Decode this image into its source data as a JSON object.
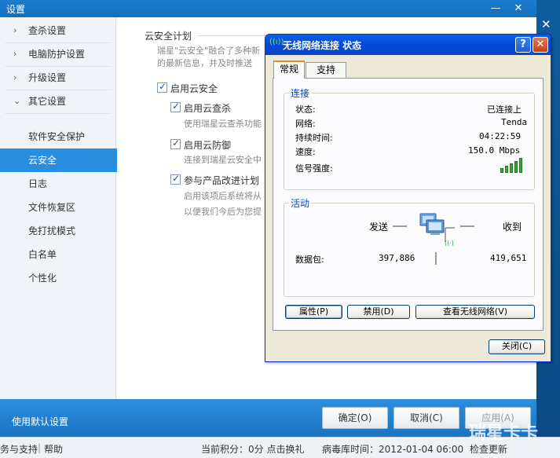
{
  "main_window": {
    "title": "设置",
    "min_glyph": "—",
    "close_glyph": "✕"
  },
  "sidebar": {
    "groups": [
      {
        "label": "查杀设置",
        "arrow": "›"
      },
      {
        "label": "电脑防护设置",
        "arrow": "›"
      },
      {
        "label": "升级设置",
        "arrow": "›"
      },
      {
        "label": "其它设置",
        "arrow": "⌄"
      }
    ],
    "sub_items": [
      "软件安全保护",
      "云安全",
      "日志",
      "文件恢复区",
      "免打扰模式",
      "白名单",
      "个性化"
    ],
    "active_index": 1
  },
  "content": {
    "section_title": "云安全计划",
    "desc_line1": "瑞星\"云安全\"融合了多种新",
    "desc_line2": "的最新信息，并及时推送",
    "enable_cloud": {
      "label": "启用云安全",
      "checked": true
    },
    "cloud_scan": {
      "label": "启用云查杀",
      "desc": "使用瑞星云查杀功能",
      "checked": true
    },
    "cloud_defense": {
      "label": "启用云防御",
      "desc": "连接到瑞星云安全中",
      "checked": true
    },
    "improve_plan": {
      "label": "参与产品改进计划",
      "desc1": "启用该项后系统将从",
      "desc2": "以便我们今后为您提",
      "checked": true
    }
  },
  "bottom": {
    "default_settings": "使用默认设置",
    "ok": "确定(O)",
    "cancel": "取消(C)",
    "apply": "应用(A)"
  },
  "status_bar": {
    "left": "务与支持",
    "help": "帮助",
    "points": "当前积分：0分 点击换礼",
    "virus_db": "病毒库时间：2012-01-04 06:00",
    "check_update": "检查更新"
  },
  "watermark": "瑞星卡卡",
  "right_close": "✕",
  "dialog": {
    "title": "无线网络连接 状态",
    "help_glyph": "?",
    "close_glyph": "✕",
    "tabs": [
      "常规",
      "支持"
    ],
    "connection": {
      "group_label": "连接",
      "status_label": "状态:",
      "status_value": "已连接上",
      "network_label": "网络:",
      "network_value": "Tenda",
      "duration_label": "持续时间:",
      "duration_value": "04:22:59",
      "speed_label": "速度:",
      "speed_value": "150.0 Mbps",
      "signal_label": "信号强度:",
      "signal_level": 5,
      "signal_max": 5
    },
    "activity": {
      "group_label": "活动",
      "sent_label": "发送",
      "received_label": "收到",
      "packets_label": "数据包:",
      "sent_value": "397,886",
      "received_value": "419,651"
    },
    "buttons": {
      "properties": "属性(P)",
      "disable": "禁用(D)",
      "view_wireless": "查看无线网络(V)",
      "close": "关闭(C)"
    }
  }
}
